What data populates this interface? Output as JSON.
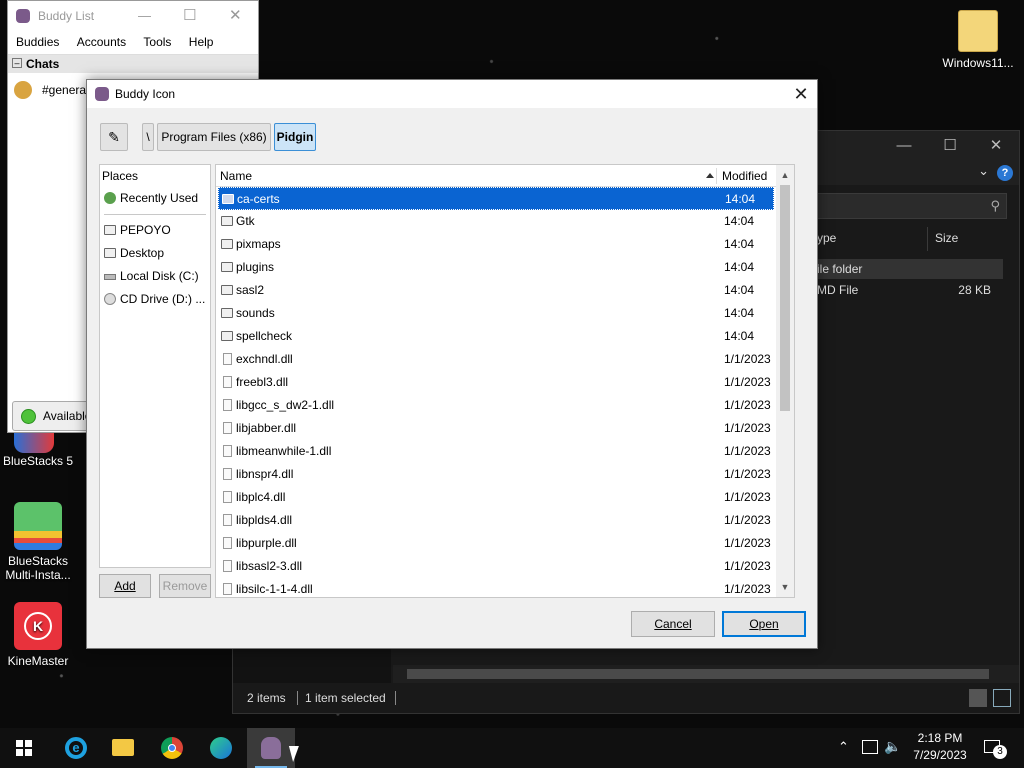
{
  "desktop": {
    "icons": [
      {
        "label": "Windows11...",
        "icon": "folder-icon"
      },
      {
        "label": "BlueStacks 5",
        "icon": "bluestacks-icon"
      },
      {
        "label": "BlueStacks Multi-Insta...",
        "icon": "bluestacks-multi-icon"
      },
      {
        "label": "KineMaster",
        "icon": "kinemaster-icon"
      }
    ]
  },
  "buddy_list": {
    "title": "Buddy List",
    "menu": [
      "Buddies",
      "Accounts",
      "Tools",
      "Help"
    ],
    "group": "Chats",
    "chat_item": "#genera",
    "status": "Available"
  },
  "explorer": {
    "columns": {
      "type": "ype",
      "size": "Size"
    },
    "rows": [
      {
        "type": "ile folder",
        "size": ""
      },
      {
        "type": "MD File",
        "size": "28 KB"
      }
    ],
    "status": {
      "items": "2 items",
      "selected": "1 item selected"
    }
  },
  "dialog": {
    "title": "Buddy Icon",
    "breadcrumb": [
      "\\",
      "Program Files (x86)",
      "Pidgin"
    ],
    "places": {
      "header": "Places",
      "items": [
        {
          "label": "Recently Used",
          "icon": "recent-icon"
        },
        {
          "label": "PEPOYO",
          "icon": "folder-icon"
        },
        {
          "label": "Desktop",
          "icon": "folder-icon"
        },
        {
          "label": "Local Disk (C:)",
          "icon": "drive-icon"
        },
        {
          "label": "CD Drive (D:) ...",
          "icon": "cd-drive-icon"
        }
      ],
      "add_label": "Add",
      "remove_label": "Remove"
    },
    "files": {
      "col_name": "Name",
      "col_modified": "Modified",
      "rows": [
        {
          "name": "ca-certs",
          "modified": "14:04",
          "kind": "folder"
        },
        {
          "name": "Gtk",
          "modified": "14:04",
          "kind": "folder"
        },
        {
          "name": "pixmaps",
          "modified": "14:04",
          "kind": "folder"
        },
        {
          "name": "plugins",
          "modified": "14:04",
          "kind": "folder"
        },
        {
          "name": "sasl2",
          "modified": "14:04",
          "kind": "folder"
        },
        {
          "name": "sounds",
          "modified": "14:04",
          "kind": "folder"
        },
        {
          "name": "spellcheck",
          "modified": "14:04",
          "kind": "folder"
        },
        {
          "name": "exchndl.dll",
          "modified": "1/1/2023",
          "kind": "file"
        },
        {
          "name": "freebl3.dll",
          "modified": "1/1/2023",
          "kind": "file"
        },
        {
          "name": "libgcc_s_dw2-1.dll",
          "modified": "1/1/2023",
          "kind": "file"
        },
        {
          "name": "libjabber.dll",
          "modified": "1/1/2023",
          "kind": "file"
        },
        {
          "name": "libmeanwhile-1.dll",
          "modified": "1/1/2023",
          "kind": "file"
        },
        {
          "name": "libnspr4.dll",
          "modified": "1/1/2023",
          "kind": "file"
        },
        {
          "name": "libplc4.dll",
          "modified": "1/1/2023",
          "kind": "file"
        },
        {
          "name": "libplds4.dll",
          "modified": "1/1/2023",
          "kind": "file"
        },
        {
          "name": "libpurple.dll",
          "modified": "1/1/2023",
          "kind": "file"
        },
        {
          "name": "libsasl2-3.dll",
          "modified": "1/1/2023",
          "kind": "file"
        },
        {
          "name": "libsilc-1-1-4.dll",
          "modified": "1/1/2023",
          "kind": "file"
        }
      ],
      "selected_index": 0
    },
    "cancel_label": "Cancel",
    "open_label": "Open"
  },
  "taskbar": {
    "apps": [
      "start-icon",
      "ie-icon",
      "file-explorer-icon",
      "chrome-icon",
      "edge-icon",
      "pidgin-icon"
    ],
    "time": "2:18 PM",
    "date": "7/29/2023",
    "notifications": "3"
  },
  "colors": {
    "selection": "#0a64d2",
    "accent": "#0078d7"
  }
}
